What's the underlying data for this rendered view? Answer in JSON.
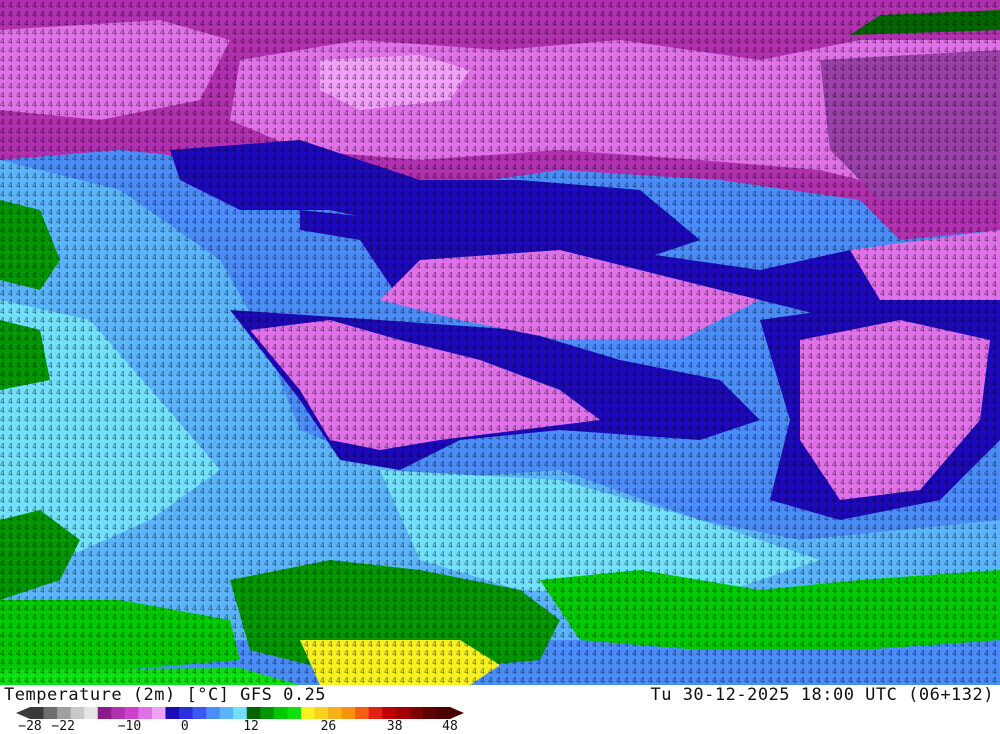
{
  "title": "Temperature (2m) [°C] GFS 0.25",
  "datetime": "Tu 30-12-2025 18:00 UTC (06+132)",
  "colorbar": {
    "colors": [
      "#3a3a3a",
      "#6e6e6e",
      "#a0a0a0",
      "#c8c8c8",
      "#e4e4e4",
      "#8c1a8c",
      "#b030b0",
      "#d040d0",
      "#e070e8",
      "#f0a0f8",
      "#1c0ab4",
      "#2830dc",
      "#3c5af0",
      "#4a8cf8",
      "#5ab4fc",
      "#70e0fc",
      "#006400",
      "#009600",
      "#00c800",
      "#10e010",
      "#f8f020",
      "#f8d020",
      "#f8b018",
      "#f89010",
      "#f06010",
      "#e02010",
      "#c00000",
      "#a00000",
      "#800000",
      "#600000",
      "#4a0000"
    ],
    "tick_labels": [
      "-28",
      "-22",
      "-10",
      "0",
      "12",
      "26",
      "38",
      "48"
    ]
  },
  "legend_colors": {
    "deep_blue": "#1c0ab4",
    "blue": "#3c5af0",
    "cyan": "#70e0fc",
    "magenta": "#e070e8",
    "violet": "#9a40a8",
    "green": "#009600",
    "yellow": "#f8f020"
  }
}
